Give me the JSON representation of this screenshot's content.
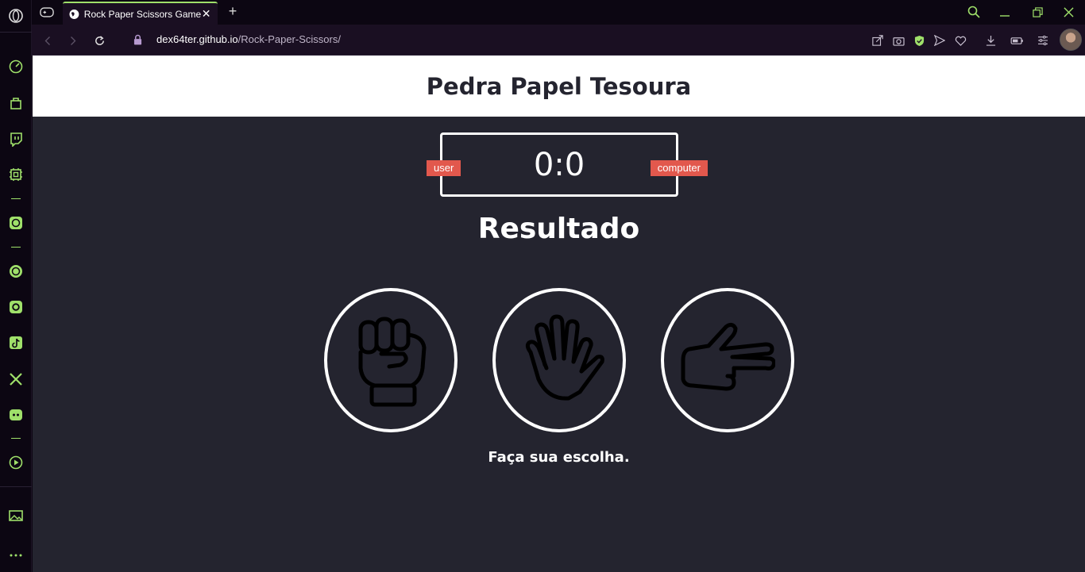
{
  "browser": {
    "tab": {
      "title": "Rock Paper Scissors Game"
    },
    "address": {
      "host": "dex64ter.github.io",
      "path": "/Rock-Paper-Scissors/"
    },
    "accent_color": "#9fe06a"
  },
  "sidebar": {
    "items": [
      "speed-dial-icon",
      "bag-icon",
      "twitch-icon",
      "gx-control-icon",
      "chatgpt-icon",
      "whatsapp-icon",
      "instagram-icon",
      "tiktok-icon",
      "x-icon",
      "discord-icon",
      "player-icon",
      "gallery-icon",
      "more-icon"
    ]
  },
  "game": {
    "title": "Pedra Papel Tesoura",
    "score": "0:0",
    "user_label": "user",
    "computer_label": "computer",
    "result": "Resultado",
    "message": "Faça sua escolha.",
    "choices": [
      "rock",
      "paper",
      "scissors"
    ],
    "badge_color": "#e2584d",
    "background_color": "#24242f"
  }
}
